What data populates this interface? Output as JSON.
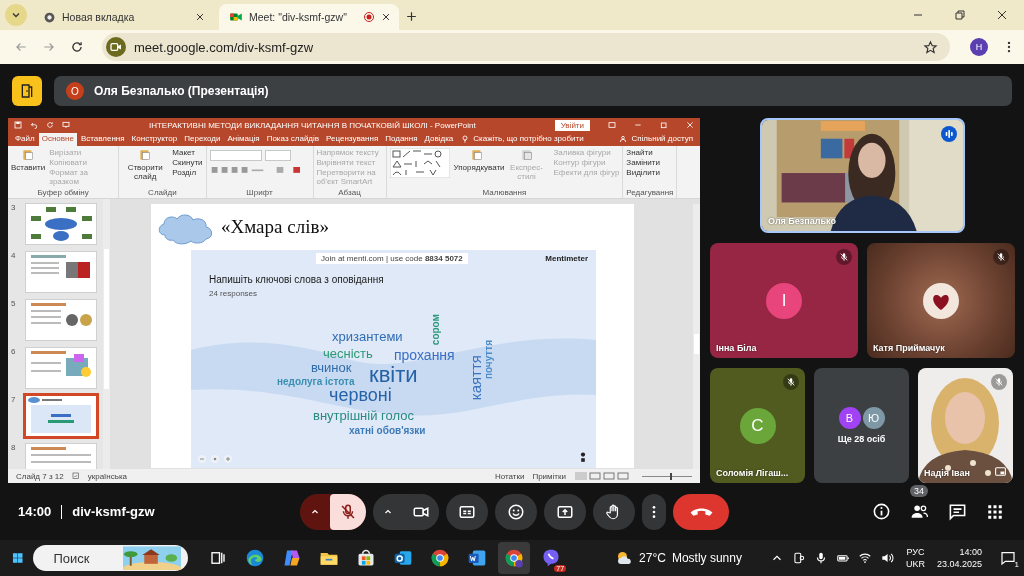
{
  "browser": {
    "tabs": [
      {
        "title": "Новая вкладка",
        "kind": "newtab",
        "selected": false,
        "recording": false
      },
      {
        "title": "Meet: \"div-ksmf-gzw\"",
        "kind": "meet",
        "selected": true,
        "recording": true
      }
    ],
    "address": "meet.google.com/div-ksmf-gzw",
    "profile_initial": "H"
  },
  "presenter_bar": {
    "initial": "О",
    "label": "Оля Безпалько (Презентація)"
  },
  "presentation": {
    "title": "ІНТЕРАКТИВНІ МЕТОДИ ВИКЛАДАННЯ ЧИТАННЯ В ПОЧАТКОВІЙ ШКОЛІ - PowerPoint",
    "signin": "Увійти",
    "tabs": [
      {
        "label": "Файл",
        "selected": false
      },
      {
        "label": "Основне",
        "selected": true
      },
      {
        "label": "Вставлення",
        "selected": false
      },
      {
        "label": "Конструктор",
        "selected": false
      },
      {
        "label": "Переходи",
        "selected": false
      },
      {
        "label": "Анімація",
        "selected": false
      },
      {
        "label": "Показ слайдів",
        "selected": false
      },
      {
        "label": "Рецензування",
        "selected": false
      },
      {
        "label": "Подання",
        "selected": false
      },
      {
        "label": "Довідка",
        "selected": false
      }
    ],
    "tell_me": "Скажіть, що потрібно зробити",
    "share": "Спільний доступ",
    "ribbon_groups": [
      {
        "label": "Буфер обміну",
        "kind": "buttons",
        "items": [
          {
            "label": "Вставити",
            "kind": "large",
            "disabled": false
          },
          {
            "label": "Вирізати",
            "kind": "small",
            "disabled": true
          },
          {
            "label": "Копіювати",
            "kind": "small",
            "disabled": true
          },
          {
            "label": "Формат за зразком",
            "kind": "small",
            "disabled": true
          }
        ]
      },
      {
        "label": "Слайди",
        "kind": "buttons",
        "items": [
          {
            "label": "Створити слайд",
            "kind": "large",
            "disabled": false
          },
          {
            "label": "Макет",
            "kind": "small",
            "disabled": false
          },
          {
            "label": "Скинути",
            "kind": "small",
            "disabled": false
          },
          {
            "label": "Розділ",
            "kind": "small",
            "disabled": false
          }
        ]
      },
      {
        "label": "Шрифт",
        "kind": "font"
      },
      {
        "label": "Абзац",
        "kind": "buttons",
        "items": [
          {
            "label": "Напрямок тексту",
            "kind": "small",
            "disabled": true
          },
          {
            "label": "Вирівняти текст",
            "kind": "small",
            "disabled": true
          },
          {
            "label": "Перетворити на об'єкт SmartArt",
            "kind": "small",
            "disabled": true
          }
        ]
      },
      {
        "label": "Малювання",
        "kind": "shapes",
        "items": [
          {
            "label": "Упорядкувати",
            "kind": "large",
            "disabled": false
          },
          {
            "label": "Експрес-стилі",
            "kind": "large",
            "disabled": true
          },
          {
            "label": "Заливка фігури",
            "kind": "small",
            "disabled": true
          },
          {
            "label": "Контур фігури",
            "kind": "small",
            "disabled": true
          },
          {
            "label": "Ефекти для фігур",
            "kind": "small",
            "disabled": true
          }
        ]
      },
      {
        "label": "Редагування",
        "kind": "buttons",
        "items": [
          {
            "label": "Знайти",
            "kind": "small",
            "disabled": false
          },
          {
            "label": "Замінити",
            "kind": "small",
            "disabled": false
          },
          {
            "label": "Виділити",
            "kind": "small",
            "disabled": false
          }
        ]
      }
    ],
    "thumbnails": [
      {
        "number": "3",
        "selected": false
      },
      {
        "number": "4",
        "selected": false
      },
      {
        "number": "5",
        "selected": false
      },
      {
        "number": "6",
        "selected": false
      },
      {
        "number": "7",
        "selected": true
      },
      {
        "number": "8",
        "selected": false
      }
    ],
    "slide": {
      "title": "«Хмара слів»",
      "menti": {
        "join": "Join at menti.com | use code **8834 5072**",
        "brand": "Mentimeter",
        "question": "Напишіть ключові слова з оповідання",
        "responses": "24 responses",
        "words": [
          {
            "text": "хризантеми",
            "kind": "horizontal",
            "color": "#2f6db5"
          },
          {
            "text": "сором",
            "kind": "vertical",
            "color": "#2f9a7e"
          },
          {
            "text": "чесність",
            "kind": "horizontal",
            "color": "#2a9a74"
          },
          {
            "text": "прохання",
            "kind": "horizontal",
            "color": "#3a6fc4"
          },
          {
            "text": "каяття",
            "kind": "vertical",
            "color": "#3a73c0"
          },
          {
            "text": "почуття",
            "kind": "vertical",
            "color": "#4d8ec8"
          },
          {
            "text": "вчинок",
            "kind": "horizontal",
            "color": "#2f6ca8"
          },
          {
            "text": "квіти",
            "kind": "horizontal",
            "color": "#2561a6"
          },
          {
            "text": "недолуга істота",
            "kind": "horizontal",
            "color": "#3a8fb0"
          },
          {
            "text": "червоні",
            "kind": "horizontal",
            "color": "#2563a8"
          },
          {
            "text": "внутрішній голос",
            "kind": "horizontal",
            "color": "#2a8a82"
          },
          {
            "text": "хатні обов'язки",
            "kind": "horizontal",
            "color": "#3d7ab8"
          }
        ]
      }
    },
    "status": {
      "slide": "Слайд 7 з 12",
      "language": "українська",
      "notes": "Нотатки",
      "comments": "Примітки",
      "zoom": {
        "level": 0.55
      }
    }
  },
  "participants": [
    {
      "name": "Оля Безпалько",
      "kind": "video",
      "muted": false,
      "self": false
    },
    {
      "name": "Інна Біла",
      "kind": "avatar",
      "initial": "І",
      "color": "#e8457c",
      "muted": true,
      "self": false
    },
    {
      "name": "Катя Приймачук",
      "kind": "picture_avatar",
      "muted": true,
      "self": false
    },
    {
      "name": "Соломія Лігаш...",
      "kind": "avatar",
      "initial": "С",
      "color": "#6aa63a",
      "muted": true,
      "self": false
    },
    {
      "name": "Надія Іван",
      "kind": "video",
      "muted": true,
      "self": true
    }
  ],
  "others": {
    "label": "Ще 28 осіб",
    "avatars": [
      {
        "initial": "В",
        "color": "#a142f4"
      },
      {
        "initial": "Ю",
        "color": "#7e98a6"
      }
    ]
  },
  "meeting": {
    "time": "14:00",
    "code": "div-ksmf-gzw"
  },
  "controls": [
    {
      "kind": "mic",
      "on": false
    },
    {
      "kind": "camera",
      "on": true
    },
    {
      "kind": "captions"
    },
    {
      "kind": "emoji"
    },
    {
      "kind": "present"
    },
    {
      "kind": "hand"
    },
    {
      "kind": "more"
    },
    {
      "kind": "end_call"
    }
  ],
  "side_buttons": [
    {
      "kind": "info"
    },
    {
      "kind": "people",
      "badge": "34"
    },
    {
      "kind": "chat"
    },
    {
      "kind": "activities"
    }
  ],
  "taskbar": {
    "search_placeholder": "Поиск",
    "apps": [
      {
        "kind": "taskview",
        "selected": false
      },
      {
        "kind": "edge",
        "selected": false
      },
      {
        "kind": "copilot",
        "selected": false
      },
      {
        "kind": "explorer",
        "selected": false
      },
      {
        "kind": "store",
        "selected": false
      },
      {
        "kind": "outlook",
        "selected": false
      },
      {
        "kind": "chrome",
        "selected": false
      },
      {
        "kind": "word",
        "selected": false
      },
      {
        "kind": "chrome_profile",
        "selected": true
      },
      {
        "kind": "viber",
        "selected": false,
        "badge": "77"
      }
    ],
    "weather": {
      "temp": "27°C",
      "text": "Mostly sunny"
    },
    "lang": [
      "РУС",
      "UKR"
    ],
    "time": "14:00",
    "date": "23.04.2025",
    "notifications": "1"
  }
}
